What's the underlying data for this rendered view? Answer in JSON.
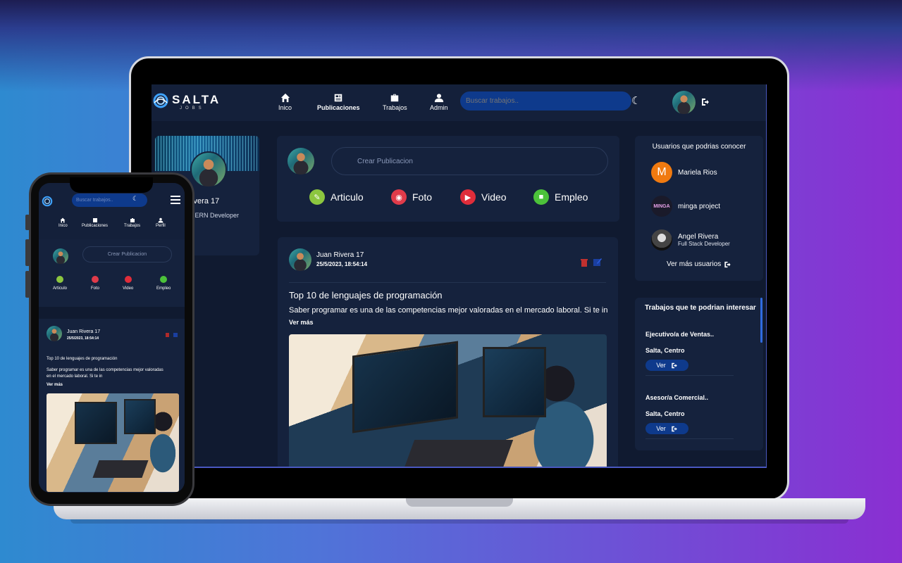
{
  "brand": {
    "name": "SALTA",
    "sub": "JOBS"
  },
  "nav": [
    {
      "label": "Inico"
    },
    {
      "label": "Publicaciones"
    },
    {
      "label": "Trabajos"
    },
    {
      "label": "Admin"
    }
  ],
  "search": {
    "placeholder": "Buscar trabajos.."
  },
  "profile": {
    "name": "Juan Rivera 17",
    "role": "Full Stack MERN Developer",
    "name_visible": "n Rivera 17",
    "role_visible": "k MERN Developer"
  },
  "create": {
    "placeholder": "Crear Publicacion",
    "actions": [
      {
        "label": "Articulo",
        "color": "#8cc63f"
      },
      {
        "label": "Foto",
        "color": "#e03b4a"
      },
      {
        "label": "Video",
        "color": "#e02d3a"
      },
      {
        "label": "Empleo",
        "color": "#4cc23a"
      }
    ]
  },
  "post": {
    "author": "Juan Rivera 17",
    "date": "25/5/2023, 18:54:14",
    "title": "Top 10 de lenguajes de programación",
    "body": "Saber programar es una de las competencias mejor valoradas en el mercado laboral. Si te in",
    "more": "Ver más"
  },
  "users": {
    "title": "Usuarios que podrias conocer",
    "items": [
      {
        "name": "Mariela Rios",
        "role": "",
        "initial": "M",
        "color": "#f07a10"
      },
      {
        "name": "minga project",
        "role": "",
        "initial": "",
        "color": "#1a1a2a"
      },
      {
        "name": "Angel Rivera",
        "role": "Full Stack Developer",
        "initial": "",
        "color": "#2a2a2a"
      }
    ],
    "see_more": "Ver más usuarios"
  },
  "jobs": {
    "title": "Trabajos que te podrian interesar",
    "items": [
      {
        "title": "Ejecutivo/a de Ventas..",
        "location": "Salta, Centro",
        "button": "Ver"
      },
      {
        "title": "Asesor/a Comercial..",
        "location": "Salta, Centro",
        "button": "Ver"
      }
    ]
  },
  "mobile": {
    "search_placeholder": "Buscar trabajos..",
    "nav": [
      {
        "label": "Inico"
      },
      {
        "label": "Publicaciones"
      },
      {
        "label": "Trabajos"
      },
      {
        "label": "Perfil"
      }
    ],
    "create_placeholder": "Crear Publicacion",
    "actions": [
      "Articulo",
      "Foto",
      "Video",
      "Empleo"
    ],
    "post": {
      "author": "Juan Rivera 17",
      "date": "25/5/2023, 18:54:14",
      "title": "Top 10 de lenguajes de programación",
      "body": "Saber programar es una de las competencias mejor valoradas en el mercado laboral. Si te in",
      "more": "Ver más"
    }
  }
}
